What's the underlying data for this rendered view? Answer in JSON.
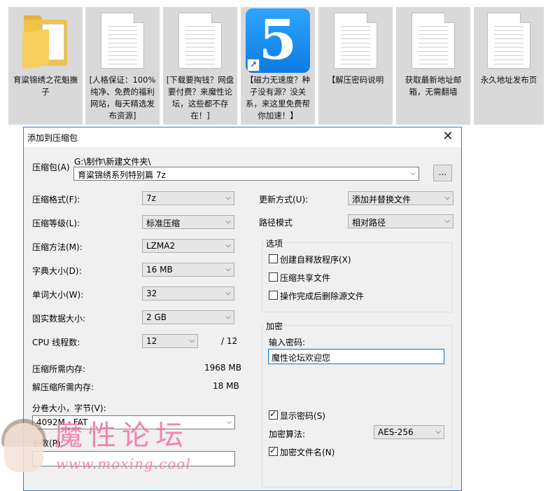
{
  "desktop_icons": [
    {
      "caption": "育粱锦绣之花魁撫子",
      "icon": "folder-icon"
    },
    {
      "caption": "[人格保证：100%纯净、免费的福利网站，每天精选发布资源]",
      "icon": "document-icon"
    },
    {
      "caption": "[下载要掏钱？网盘要付费？来魔性论坛，这些都不存在！]",
      "icon": "document-icon"
    },
    {
      "caption": "【磁力无速度？种子没有源？没关系，来这里免费帮你加速！】",
      "icon": "app-5-icon",
      "app_glyph": "5",
      "shortcut_glyph": "↗"
    },
    {
      "caption": "【解压密码说明",
      "icon": "document-icon"
    },
    {
      "caption": "获取最新地址邮箱，无需翻墙",
      "icon": "document-icon"
    },
    {
      "caption": "永久地址发布页",
      "icon": "document-icon"
    }
  ],
  "dialog": {
    "title": "添加到压缩包",
    "close_glyph": "✕",
    "archive_label": "压缩包(A)",
    "archive_path": "G:\\制作\\新建文件夹\\",
    "archive_name": "育粱锦绣系列特别篇 7z",
    "browse_label": "...",
    "format_label": "压缩格式(F):",
    "format_value": "7z",
    "level_label": "压缩等级(L):",
    "level_value": "标准压缩",
    "method_label": "压缩方法(M):",
    "method_value": "LZMA2",
    "dict_label": "字典大小(D):",
    "dict_value": "16 MB",
    "word_label": "单词大小(W):",
    "word_value": "32",
    "solid_label": "固实数据大小:",
    "solid_value": "2 GB",
    "threads_label": "CPU 线程数:",
    "threads_value": "12",
    "threads_max": "/ 12",
    "mem_compress_label": "压缩所需内存:",
    "mem_compress_value": "1968 MB",
    "mem_decompress_label": "解压缩所需内存:",
    "mem_decompress_value": "18 MB",
    "split_label": "分卷大小，字节(V):",
    "split_value": "4092M - FAT",
    "params_label": "参数(P):",
    "params_value": "",
    "update_label": "更新方式(U):",
    "update_value": "添加并替换文件",
    "path_label": "路径模式",
    "path_value": "相对路径",
    "options_group": "选项",
    "opt_sfx": "创建自释放程序(X)",
    "opt_shared": "压缩共享文件",
    "opt_delete": "操作完成后删除源文件",
    "encrypt_group": "加密",
    "password_label": "输入密码:",
    "password_value": "魔性论坛欢迎您",
    "show_password": "显示密码(S)",
    "enc_method_label": "加密算法:",
    "enc_method_value": "AES-256",
    "enc_names": "加密文件名(N)",
    "dropdown_glyph": "⌵"
  },
  "watermark": {
    "text": "魔性论坛",
    "url": "www.moxing.cool"
  }
}
